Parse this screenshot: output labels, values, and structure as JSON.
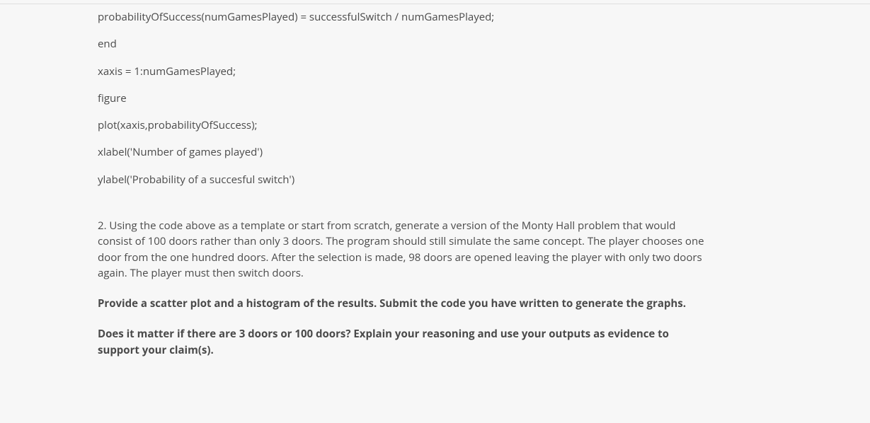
{
  "code": {
    "lines": [
      "probabilityOfSuccess(numGamesPlayed) = successfulSwitch / numGamesPlayed;",
      "end",
      "xaxis = 1:numGamesPlayed;",
      "figure",
      "plot(xaxis,probabilityOfSuccess);",
      "xlabel('Number of games played')",
      "ylabel('Probability of a succesful switch')"
    ]
  },
  "question": {
    "intro": "2.  Using the code above as a template or start from scratch, generate a version of the Monty Hall problem that would consist of 100 doors rather than only 3 doors.  The program should still simulate the same concept.  The player chooses one door from the one hundred doors.  After the selection is made, 98 doors are opened leaving the player with only two doors again.  The player must then switch doors.",
    "bold1": "Provide a scatter plot and a histogram of the results.  Submit the code you have written to generate the graphs.",
    "bold2": "Does it matter if there are 3 doors or 100 doors?  Explain your reasoning and use your outputs as evidence to support your claim(s)."
  }
}
